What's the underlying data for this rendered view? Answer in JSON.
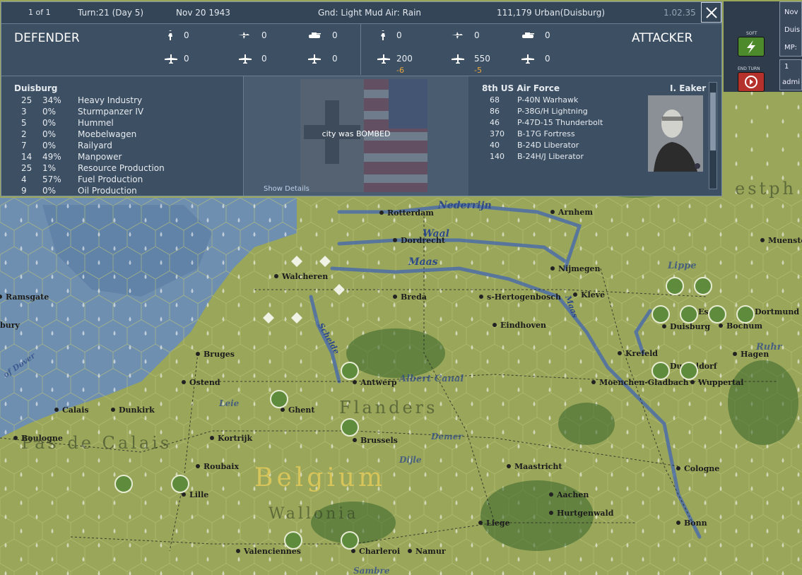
{
  "topbar": {
    "page": "1 of 1",
    "turn": "Turn:21 (Day 5)",
    "date": "Nov 20 1943",
    "weather": "Gnd: Light Mud  Air: Rain",
    "location": "111,179  Urban(Duisburg)",
    "version": "1.02.35"
  },
  "defender": {
    "title": "DEFENDER",
    "counts": [
      "0",
      "0",
      "0",
      "0",
      "0",
      "0"
    ]
  },
  "attacker": {
    "title": "ATTACKER",
    "counts": [
      "0",
      "0",
      "0",
      "200",
      "550",
      "0"
    ],
    "losses": [
      "-6",
      "-5"
    ]
  },
  "target": {
    "name": "Duisburg",
    "rows": [
      {
        "num": "25",
        "pct": "34%",
        "label": "Heavy Industry"
      },
      {
        "num": "3",
        "pct": "0%",
        "label": "Sturmpanzer IV"
      },
      {
        "num": "5",
        "pct": "0%",
        "label": "Hummel"
      },
      {
        "num": "2",
        "pct": "0%",
        "label": "Moebelwagen"
      },
      {
        "num": "7",
        "pct": "0%",
        "label": "Railyard"
      },
      {
        "num": "14",
        "pct": "49%",
        "label": "Manpower"
      },
      {
        "num": "25",
        "pct": "1%",
        "label": "Resource Production"
      },
      {
        "num": "4",
        "pct": "57%",
        "label": "Fuel Production"
      },
      {
        "num": "9",
        "pct": "0%",
        "label": "Oil Production"
      }
    ]
  },
  "result": {
    "message": "city was BOMBED",
    "details_link": "Show Details"
  },
  "airforce": {
    "name": "8th US Air Force",
    "commander": "I. Eaker",
    "rows": [
      {
        "num": "68",
        "label": "P-40N Warhawk"
      },
      {
        "num": "86",
        "label": "P-38G/H Lightning"
      },
      {
        "num": "46",
        "label": "P-47D-15 Thunderbolt"
      },
      {
        "num": "370",
        "label": "B-17G Fortress"
      },
      {
        "num": "40",
        "label": "B-24D Liberator"
      },
      {
        "num": "140",
        "label": "B-24H/J Liberator"
      }
    ]
  },
  "sidepanel": {
    "soft_label": "SOFT",
    "end_turn_label": "END TURN",
    "info_lines": [
      "Nov",
      "Duis",
      "MP:"
    ],
    "player_lines": [
      "1",
      "admi"
    ]
  },
  "map": {
    "cities": [
      "Rotterdam",
      "Arnhem",
      "Dordrecht",
      "Nijmegen",
      "Walcheren",
      "Breda",
      "s-Hertogenbosch",
      "Kleve",
      "Eindhoven",
      "Duisburg",
      "Essen",
      "Bochum",
      "Dortmund",
      "Krefeld",
      "Hagen",
      "Muenster",
      "Ramsgate",
      "Bruges",
      "Ostend",
      "Antwerp",
      "Moenchen-Gladbach",
      "Dusseldorf",
      "Wuppertal",
      "Calais",
      "Dunkirk",
      "Ghent",
      "Boulogne",
      "Kortrijk",
      "Brussels",
      "Roubaix",
      "Maastricht",
      "Cologne",
      "Lille",
      "Aachen",
      "Liege",
      "Hurtgenwald",
      "Bonn",
      "Valenciennes",
      "Charleroi",
      "Namur",
      "bury"
    ],
    "rivers": [
      "Nederrijn",
      "Waal",
      "Maas",
      "Schelde",
      "Albert Canal",
      "Leie",
      "Dijle",
      "Demer",
      "Maas",
      "Ruhr",
      "Lippe",
      "Sambre",
      "of Dover"
    ],
    "regions": [
      "Flanders",
      "Pas de Calais",
      "Belgium",
      "Wallonia",
      "estph"
    ],
    "land_color": "#9aa65a",
    "sea_color": "#6f8fb0",
    "river_color": "#4d6ea8"
  }
}
